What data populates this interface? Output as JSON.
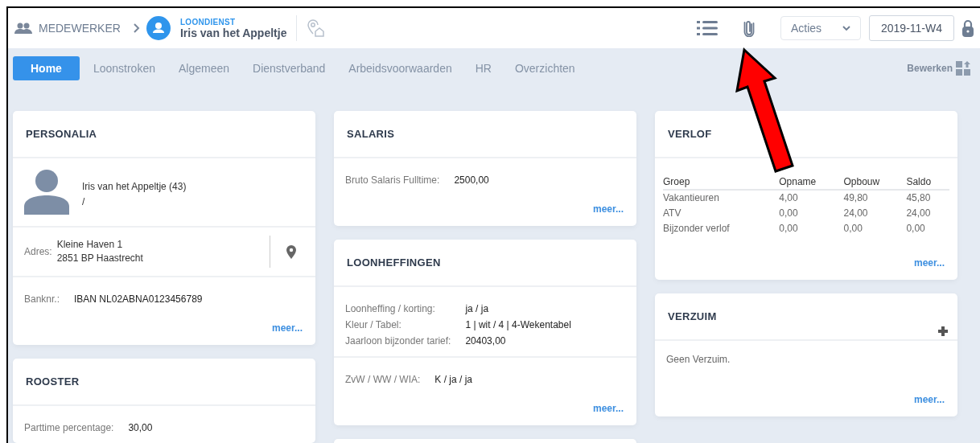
{
  "header": {
    "breadcrumb": "MEDEWERKER",
    "context": "LOONDIENST",
    "name": "Iris van het Appeltje",
    "actions": "Acties",
    "period": "2019-11-W4"
  },
  "tabs": [
    {
      "label": "Home",
      "selected": true
    },
    {
      "label": "Loonstroken",
      "selected": false
    },
    {
      "label": "Algemeen",
      "selected": false
    },
    {
      "label": "Dienstverband",
      "selected": false
    },
    {
      "label": "Arbeidsvoorwaarden",
      "selected": false
    },
    {
      "label": "HR",
      "selected": false
    },
    {
      "label": "Overzichten",
      "selected": false
    }
  ],
  "edit_button": "Bewerken",
  "columns": [
    [
      {
        "title": "PERSONALIA",
        "sections": [
          {
            "kind": "person",
            "lines": [
              "Iris van het Appeltje (43)",
              "/"
            ]
          },
          {
            "kind": "address",
            "label": "Adres:",
            "lines": [
              "Kleine Haven 1",
              "2851 BP Haastrecht"
            ]
          },
          {
            "kind": "fields",
            "rows": [
              {
                "label": "Banknr.:",
                "value": "IBAN NL02ABNA0123456789"
              }
            ]
          }
        ],
        "more": "meer..."
      },
      {
        "title": "ROOSTER",
        "sections": [
          {
            "kind": "fields",
            "rows": [
              {
                "label": "Parttime percentage:",
                "value": "30,00"
              }
            ]
          }
        ]
      }
    ],
    [
      {
        "title": "SALARIS",
        "sections": [
          {
            "kind": "fields",
            "rows": [
              {
                "label": "Bruto Salaris Fulltime:",
                "value": "2500,00"
              }
            ]
          }
        ],
        "more": "meer..."
      },
      {
        "title": "LOONHEFFINGEN",
        "sections": [
          {
            "kind": "fields",
            "rows": [
              {
                "label": "Loonheffing / korting:",
                "value": "ja / ja"
              },
              {
                "label": "Kleur / Tabel:",
                "value": "1 | wit / 4 | 4-Wekentabel"
              },
              {
                "label": "Jaarloon bijzonder tarief:",
                "value": "20403,00"
              }
            ]
          },
          {
            "kind": "fields",
            "rows": [
              {
                "label": "ZvW / WW / WIA:",
                "value": "K / ja / ja"
              }
            ]
          }
        ],
        "more": "meer..."
      },
      {}
    ],
    [
      {
        "title": "VERLOF",
        "sections": [
          {
            "kind": "table",
            "columns": [
              "Groep",
              "Opname",
              "Opbouw",
              "Saldo"
            ],
            "rows": [
              [
                "Vakantieuren",
                "4,00",
                "49,80",
                "45,80"
              ],
              [
                "ATV",
                "0,00",
                "24,00",
                "24,00"
              ],
              [
                "Bijzonder verlof",
                "0,00",
                "0,00",
                "0,00"
              ]
            ]
          }
        ],
        "more": "meer..."
      },
      {
        "title": "VERZUIM",
        "add": true,
        "sections": [
          {
            "kind": "text",
            "text": "Geen Verzuim."
          }
        ],
        "more": "meer..."
      }
    ]
  ]
}
